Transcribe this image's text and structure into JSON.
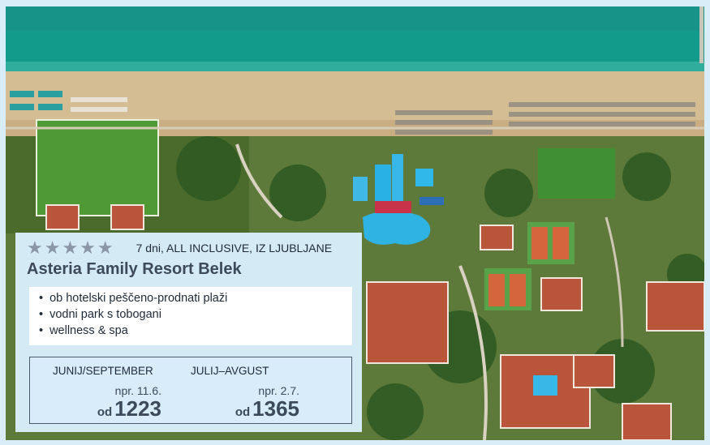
{
  "hotel": {
    "stars": "★★★★★",
    "trip_info": "7 dni, ALL INCLUSIVE, IZ LJUBLJANE",
    "name": "Asteria Family Resort Belek"
  },
  "features": [
    "ob hotelski peščeno-prodnati plaži",
    "vodni park s tobogani",
    "wellness & spa"
  ],
  "prices": [
    {
      "season": "JUNIJ/SEPTEMBER",
      "date": "npr. 11.6.",
      "prefix": "od",
      "amount": "1223"
    },
    {
      "season": "JULIJ–AVGUST",
      "date": "npr. 2.7.",
      "prefix": "od",
      "amount": "1365"
    }
  ],
  "colors": {
    "card_bg": "#daeefc",
    "title": "#3c4a5a",
    "stars": "#8a96a6",
    "sea": "#129a8a"
  }
}
